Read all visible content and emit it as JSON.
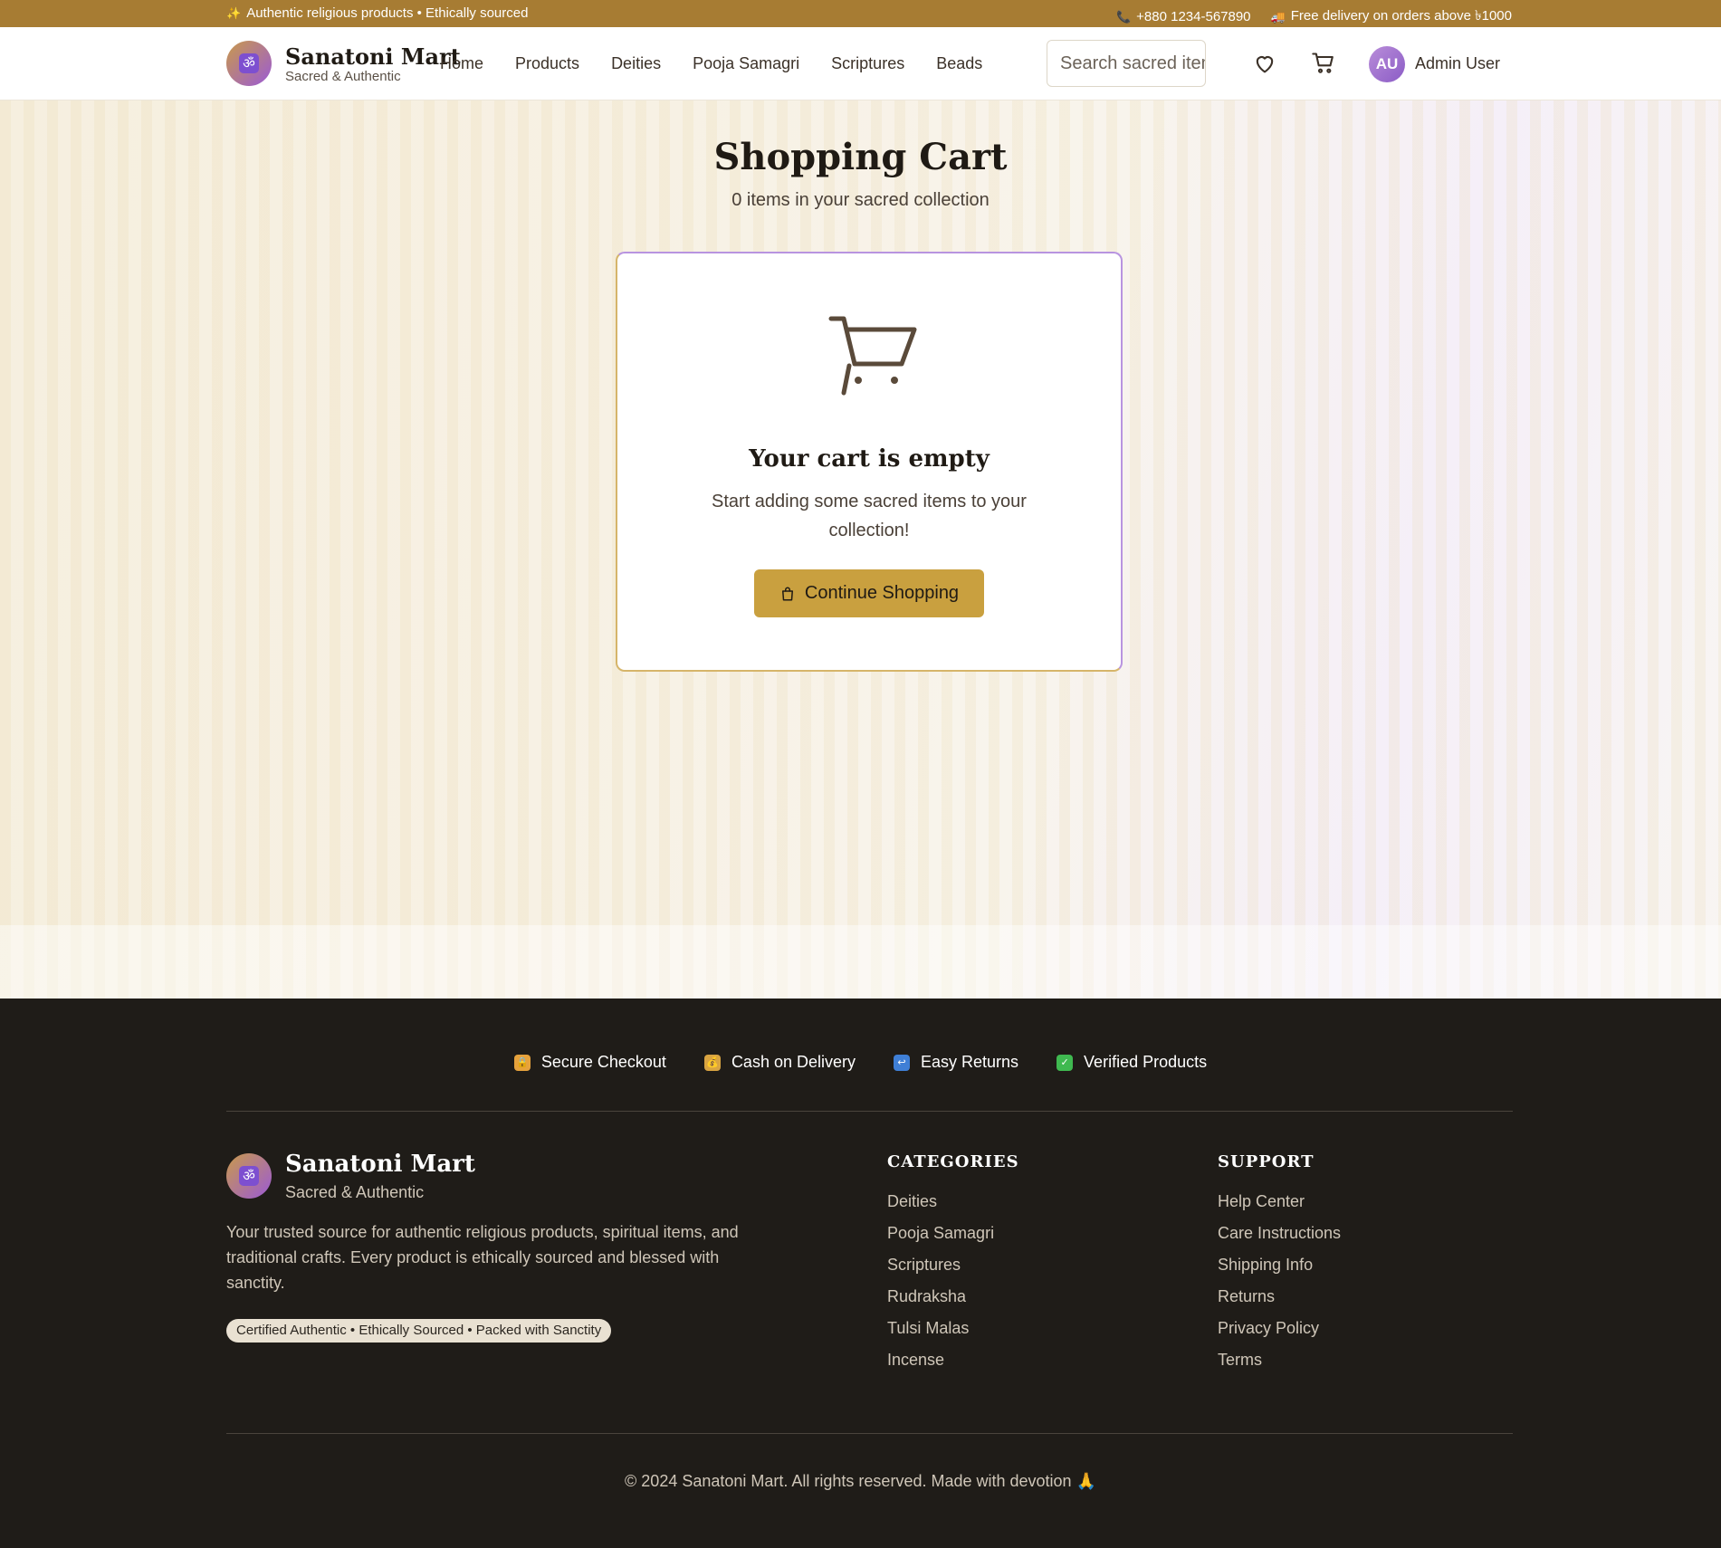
{
  "topbar": {
    "left_text": "Authentic religious products • Ethically sourced",
    "phone": "+880 1234-567890",
    "delivery": "Free delivery on orders above ৳1000"
  },
  "header": {
    "brand": "Sanatoni Mart",
    "tagline": "Sacred & Authentic",
    "logo_glyph": "ॐ",
    "nav": [
      "Home",
      "Products",
      "Deities",
      "Pooja Samagri",
      "Scriptures",
      "Beads"
    ],
    "search_placeholder": "Search sacred items...",
    "avatar_initials": "AU",
    "user_name": "Admin User",
    "icons": [
      "heart-icon",
      "cart-icon"
    ]
  },
  "main": {
    "title": "Shopping Cart",
    "subtitle": "0 items in your sacred collection",
    "empty_title": "Your cart is empty",
    "empty_text": "Start adding some sacred items to your collection!",
    "cta_label": "Continue Shopping"
  },
  "footer": {
    "trust": [
      {
        "label": "Secure Checkout",
        "icon": "lock-icon",
        "color": "#e6a23c"
      },
      {
        "label": "Cash on Delivery",
        "icon": "money-bag-icon",
        "color": "#d9a441"
      },
      {
        "label": "Easy Returns",
        "icon": "return-icon",
        "color": "#3f7fd6"
      },
      {
        "label": "Verified Products",
        "icon": "check-icon",
        "color": "#3fb950"
      }
    ],
    "brand": "Sanatoni Mart",
    "tagline": "Sacred & Authentic",
    "description": "Your trusted source for authentic religious products, spiritual items, and traditional crafts. Every product is ethically sourced and blessed with sanctity.",
    "badge": "Certified Authentic • Ethically Sourced • Packed with Sanctity",
    "categories_title": "CATEGORIES",
    "categories": [
      "Deities",
      "Pooja Samagri",
      "Scriptures",
      "Rudraksha",
      "Tulsi Malas",
      "Incense"
    ],
    "support_title": "SUPPORT",
    "support": [
      "Help Center",
      "Care Instructions",
      "Shipping Info",
      "Returns",
      "Privacy Policy",
      "Terms"
    ],
    "copyright": "© 2024 Sanatoni Mart. All rights reserved. Made with devotion 🙏"
  },
  "colors": {
    "accent_gold": "#c9a03f",
    "topbar": "#a77c33",
    "purple": "#9b5ad6",
    "footer_bg": "#1f1c18"
  }
}
